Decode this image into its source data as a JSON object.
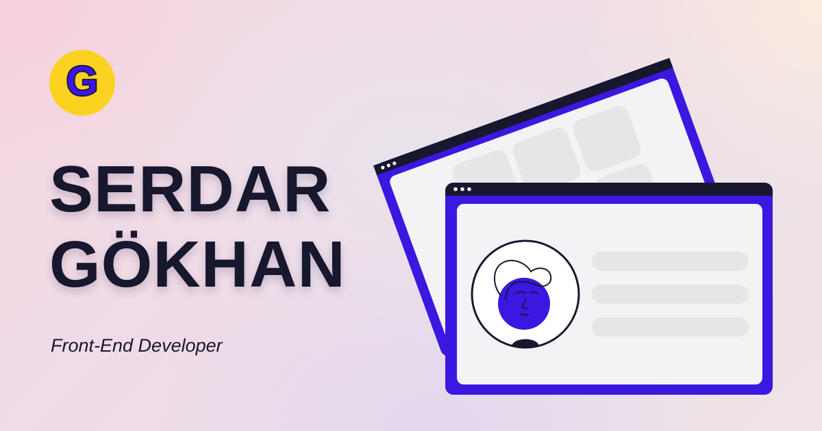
{
  "logo": {
    "letter": "G",
    "colors": {
      "fill": "#fbd21f",
      "letter": "#3b17e0",
      "outline": "#17172e"
    }
  },
  "hero": {
    "name_line1": "SERDAR",
    "name_line2": "GÖKHAN",
    "role": "Front-End Developer"
  },
  "colors": {
    "text": "#17172e",
    "accent": "#3b17e0",
    "window_bar": "#17172e",
    "window_body": "#f3f2f4",
    "placeholder": "#e6e5e7"
  },
  "illustration": {
    "back_window_icon": "browser-window-icon",
    "front_window_icon": "profile-card-icon",
    "avatar_icon": "person-avatar-icon"
  }
}
